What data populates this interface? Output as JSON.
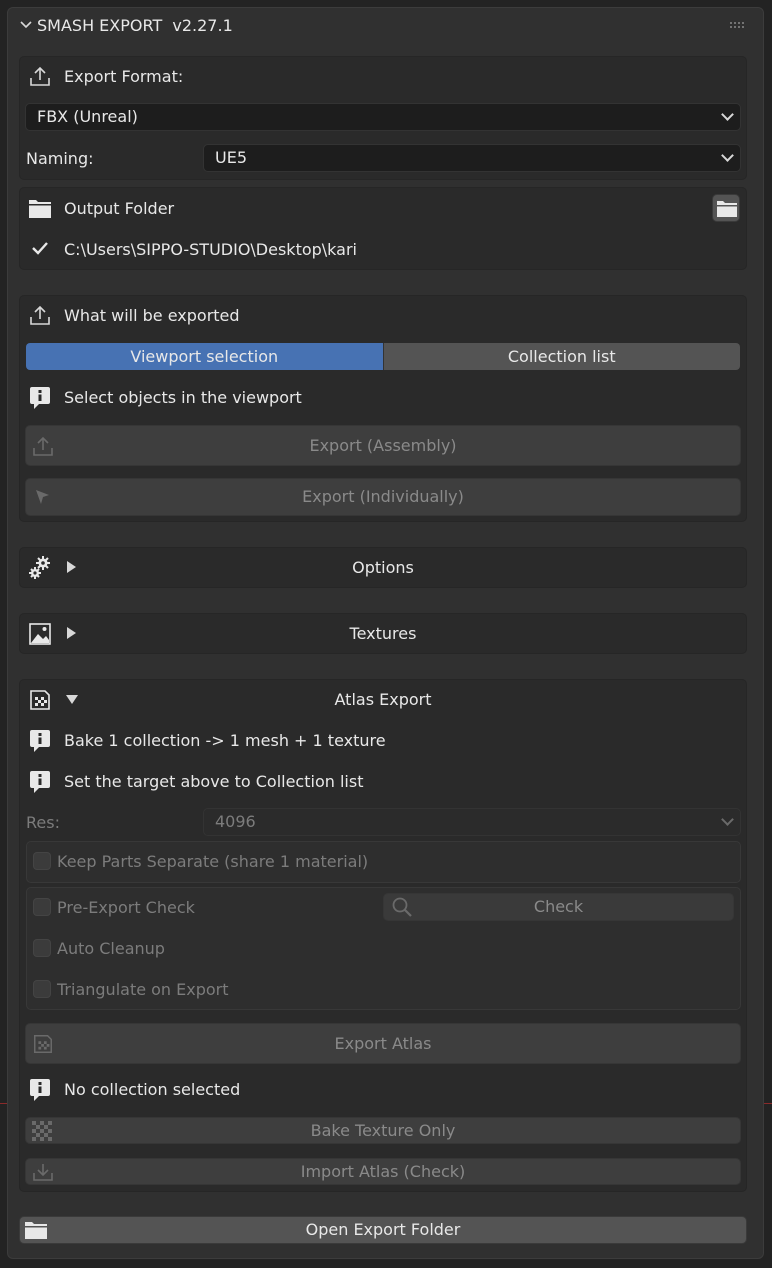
{
  "header": {
    "title": "SMASH EXPORT  v2.27.1"
  },
  "export_format": {
    "label": "Export Format:",
    "value": "FBX (Unreal)"
  },
  "naming": {
    "label": "Naming:",
    "value": "UE5"
  },
  "output": {
    "label": "Output Folder",
    "path": "C:\\Users\\SIPPO-STUDIO\\Desktop\\kari"
  },
  "what": {
    "label": "What will be exported",
    "tab_viewport": "Viewport selection",
    "tab_collection": "Collection list",
    "info": "Select objects in the viewport",
    "btn_assembly": "Export (Assembly)",
    "btn_individually": "Export (Individually)"
  },
  "options": {
    "label": "Options"
  },
  "textures": {
    "label": "Textures"
  },
  "atlas": {
    "label": "Atlas Export",
    "info1": "Bake 1 collection -> 1 mesh + 1 texture",
    "info2": "Set the target above to Collection list",
    "res_label": "Res:",
    "res_value": "4096",
    "keep_parts": "Keep Parts Separate (share 1 material)",
    "pre_export": "Pre-Export Check",
    "check_btn": "Check",
    "auto_cleanup": "Auto Cleanup",
    "triangulate": "Triangulate on Export",
    "export_atlas": "Export Atlas",
    "no_collection": "No collection selected",
    "bake_texture": "Bake Texture Only",
    "import_atlas": "Import Atlas (Check)"
  },
  "footer": {
    "open_folder": "Open Export Folder"
  }
}
